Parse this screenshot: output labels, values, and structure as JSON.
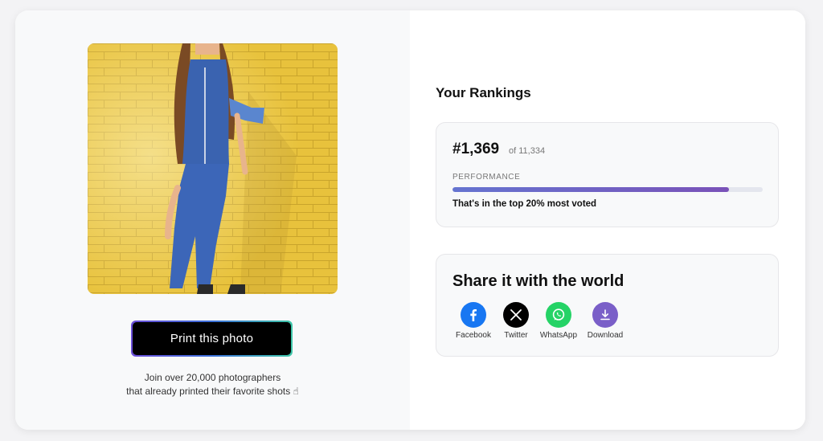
{
  "photo": {
    "alt_subject": "photo-thumbnail"
  },
  "print": {
    "button_label": "Print this photo",
    "join_line_1": "Join over 20,000 photographers",
    "join_line_2": "that already printed their favorite shots ☝"
  },
  "rankings": {
    "title": "Your Rankings",
    "rank": "#1,369",
    "of_total": "of 11,334",
    "performance_label": "PERFORMANCE",
    "performance_fraction": 0.89,
    "performance_note": "That's in the top 20% most voted"
  },
  "share": {
    "title": "Share it with the world",
    "items": [
      {
        "label": "Facebook",
        "icon": "facebook-icon",
        "color": "#1877f2"
      },
      {
        "label": "Twitter",
        "icon": "x-icon",
        "color": "#000000"
      },
      {
        "label": "WhatsApp",
        "icon": "whatsapp-icon",
        "color": "#25d366"
      },
      {
        "label": "Download",
        "icon": "download-icon",
        "color": "#7a5fc8"
      }
    ]
  }
}
